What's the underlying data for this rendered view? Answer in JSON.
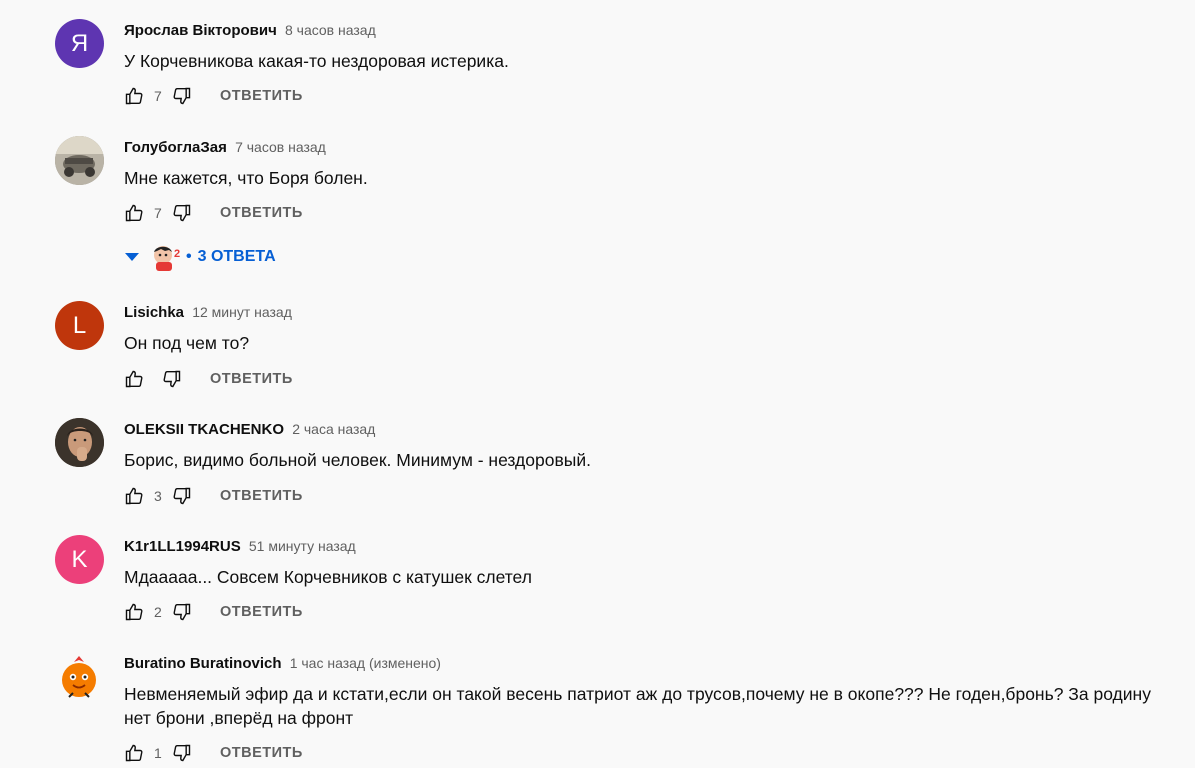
{
  "comments": [
    {
      "author": "Ярослав Вікторович",
      "time": "8 часов назад",
      "text": "У Корчевникова какая-то нездоровая истерика.",
      "likes": "7",
      "avatar_letter": "Я",
      "avatar_color": "#5e35b1",
      "reply_label": "ОТВЕТИТЬ"
    },
    {
      "author": "ГолубоглаЗая",
      "time": "7 часов назад",
      "text": "Мне кажется, что Боря болен.",
      "likes": "7",
      "reply_label": "ОТВЕТИТЬ"
    },
    {
      "author": "Lisichka",
      "time": "12 минут назад",
      "text": "Он под чем то?",
      "likes": "",
      "avatar_letter": "L",
      "avatar_color": "#bf360c",
      "reply_label": "ОТВЕТИТЬ"
    },
    {
      "author": "OLEKSII TKACHENKO",
      "time": "2 часа назад",
      "text": "Борис, видимо больной человек. Минимум - нездоровый.",
      "likes": "3",
      "reply_label": "ОТВЕТИТЬ"
    },
    {
      "author": "K1r1LL1994RUS",
      "time": "51 минуту назад",
      "text": "Мдааааа... Совсем Корчевников с катушек слетел",
      "likes": "2",
      "avatar_letter": "K",
      "avatar_color": "#ec407a",
      "reply_label": "ОТВЕТИТЬ"
    },
    {
      "author": "Buratino Buratinovich",
      "time": "1 час назад (изменено)",
      "text": "Невменяемый эфир да и кстати,если он такой весень патриот аж до трусов,почему не в окопе??? Не годен,бронь? За родину нет брони ,вперёд на фронт",
      "likes": "1",
      "reply_label": "ОТВЕТИТЬ"
    }
  ],
  "replies_toggle": {
    "label": "3 ОТВЕТА",
    "dot": "•"
  },
  "colors": {
    "accent": "#065fd4",
    "secondary_text": "#606060"
  }
}
